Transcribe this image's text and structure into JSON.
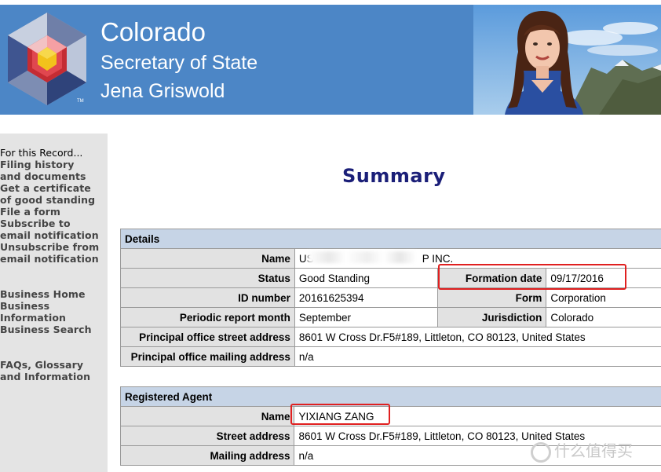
{
  "header": {
    "state": "Colorado",
    "office": "Secretary of State",
    "official": "Jena Griswold"
  },
  "sidebar": {
    "heading": "For this Record...",
    "record_links": [
      "Filing history and documents",
      "Get a certificate of good standing",
      "File a form",
      "Subscribe to email notification",
      "Unsubscribe from email notification"
    ],
    "general_links": [
      "Business Home",
      "Business Information",
      "Business Search"
    ],
    "faq_link": "FAQs, Glossary and Information"
  },
  "main": {
    "title": "Summary",
    "details": {
      "section": "Details",
      "name_label": "Name",
      "name_value": "US",
      "name_value_tail": "P INC.",
      "status_label": "Status",
      "status_value": "Good Standing",
      "formation_label": "Formation date",
      "formation_value": "09/17/2016",
      "id_label": "ID number",
      "id_value": "20161625394",
      "form_label": "Form",
      "form_value": "Corporation",
      "periodic_label": "Periodic report month",
      "periodic_value": "September",
      "jurisdiction_label": "Jurisdiction",
      "jurisdiction_value": "Colorado",
      "street_label": "Principal office street address",
      "street_value": "8601 W Cross Dr.F5#189, Littleton, CO 80123, United States",
      "mailing_label": "Principal office mailing address",
      "mailing_value": "n/a"
    },
    "agent": {
      "section": "Registered Agent",
      "name_label": "Name",
      "name_value": "YIXIANG ZANG",
      "street_label": "Street address",
      "street_value": "8601 W Cross Dr.F5#189, Littleton, CO 80123, United States",
      "mailing_label": "Mailing address",
      "mailing_value": "n/a"
    }
  },
  "watermark": "什么值得买",
  "colors": {
    "banner": "#4c86c6",
    "title": "#1b1f78",
    "section_header": "#c6d4e6",
    "label_cell": "#e2e2e2",
    "highlight": "#e02020"
  }
}
